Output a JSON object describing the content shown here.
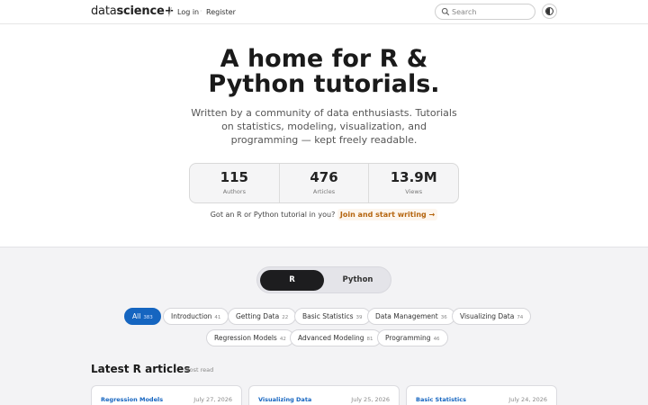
{
  "header": {
    "brand_main": "data",
    "brand_accent": "science+",
    "separator": "/",
    "login": "Log in",
    "dot": "·",
    "register": "Register",
    "search_placeholder": "Search",
    "search_icon": "search-icon",
    "theme_icon": "contrast-icon"
  },
  "hero": {
    "title_line1": "A home for R &",
    "title_line2": "Python tutorials.",
    "subtitle": "Written by a community of data enthusiasts. Tutorials on statistics, modeling, visualization, and programming — kept freely readable."
  },
  "stats": [
    {
      "value": "115",
      "label": "Authors"
    },
    {
      "value": "476",
      "label": "Articles"
    },
    {
      "value": "13.9M",
      "label": "Views"
    }
  ],
  "cta": {
    "text": "Got an R or Python tutorial in you?",
    "link": "Join and start writing →"
  },
  "language_toggle": {
    "options": [
      "R",
      "Python"
    ],
    "selected": "R"
  },
  "categories": [
    {
      "label": "All",
      "count": "383",
      "active": true
    },
    {
      "label": "Introduction",
      "count": "41"
    },
    {
      "label": "Getting Data",
      "count": "22"
    },
    {
      "label": "Basic Statistics",
      "count": "39"
    },
    {
      "label": "Data Management",
      "count": "36"
    },
    {
      "label": "Visualizing Data",
      "count": "74"
    },
    {
      "label": "Regression Models",
      "count": "42"
    },
    {
      "label": "Advanced Modeling",
      "count": "81"
    },
    {
      "label": "Programming",
      "count": "46"
    }
  ],
  "latest": {
    "title": "Latest R articles",
    "sort": "Most read"
  },
  "cards": [
    {
      "category": "Regression Models",
      "date": "July 27, 2026"
    },
    {
      "category": "Visualizing Data",
      "date": "July 25, 2026"
    },
    {
      "category": "Basic Statistics",
      "date": "July 24, 2026"
    }
  ],
  "colors": {
    "accent": "#1565c0",
    "cta": "#b5650f",
    "dark": "#1d1d1f"
  }
}
